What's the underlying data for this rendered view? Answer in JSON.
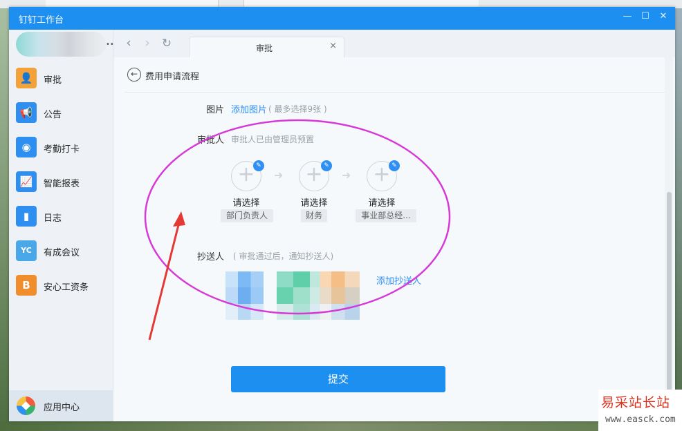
{
  "window": {
    "title": "钉钉工作台",
    "min_icon": "minimize-icon",
    "max_icon": "maximize-icon",
    "close_icon": "close-icon"
  },
  "sidebar": {
    "profile_more": "•••",
    "items": [
      {
        "label": "审批",
        "icon": "approval-icon",
        "color": "#f3a23a",
        "glyph": "👤"
      },
      {
        "label": "公告",
        "icon": "announcement-icon",
        "color": "#2e8ff0",
        "glyph": "📢"
      },
      {
        "label": "考勤打卡",
        "icon": "attendance-icon",
        "color": "#2e8ff0",
        "glyph": "◉"
      },
      {
        "label": "智能报表",
        "icon": "report-icon",
        "color": "#2e8ff0",
        "glyph": "📈"
      },
      {
        "label": "日志",
        "icon": "log-icon",
        "color": "#2e8ff0",
        "glyph": "▮"
      },
      {
        "label": "有成会议",
        "icon": "meeting-icon",
        "color": "#4aa7e8",
        "glyph": "YC"
      },
      {
        "label": "安心工资条",
        "icon": "payslip-icon",
        "color": "#f08d2c",
        "glyph": "B"
      }
    ],
    "app_center": "应用中心"
  },
  "navbar": {
    "back_icon": "‹",
    "forward_icon": "›",
    "refresh_icon": "↻",
    "tab_label": "审批",
    "tab_close": "×"
  },
  "form": {
    "back_icon": "←",
    "title": "费用申请流程",
    "image_label": "图片",
    "image_link": "添加图片",
    "image_hint": "( 最多选择9张 )",
    "approver_label": "审批人",
    "approver_hint": "审批人已由管理员预置",
    "approvers": [
      {
        "select": "请选择",
        "role": "部门负责人"
      },
      {
        "select": "请选择",
        "role": "财务"
      },
      {
        "select": "请选择",
        "role": "事业部总经..."
      }
    ],
    "flow_arrow": "➜",
    "plus": "+",
    "pencil": "✎",
    "cc_label": "抄送人",
    "cc_hint": "( 审批通过后，通知抄送人)",
    "cc_add": "添加抄送人",
    "submit": "提交"
  },
  "watermark": {
    "title": "易采站长站",
    "url": "www.easck.com"
  },
  "annotation_colors": {
    "ellipse": "#d63ad6",
    "arrow": "#e53935"
  }
}
